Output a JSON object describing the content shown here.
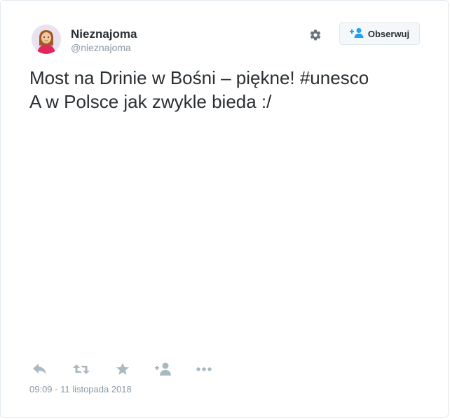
{
  "user": {
    "display_name": "Nieznajoma",
    "handle": "@nieznajoma"
  },
  "header": {
    "gear_icon": "gear-icon",
    "follow_label": "Obserwuj",
    "follow_icon": "add-user-icon"
  },
  "tweet": {
    "lines": [
      "Most na Drinie w Bośni – piękne! #unesco",
      "A w Polsce jak zwykle bieda :/"
    ],
    "timestamp": "09:09 - 11 listopada 2018"
  },
  "actions": [
    {
      "icon": "reply-icon"
    },
    {
      "icon": "retweet-icon"
    },
    {
      "icon": "favorite-star-icon"
    },
    {
      "icon": "follow-user-icon"
    },
    {
      "icon": "more-options-icon"
    }
  ],
  "colors": {
    "text": "#292f33",
    "muted": "#8899a6",
    "action_icon": "#aab8c2",
    "accent": "#1da1f2",
    "border": "#e1e8ed"
  }
}
